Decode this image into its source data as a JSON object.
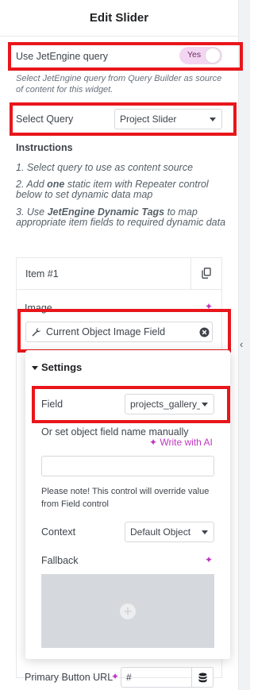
{
  "header": {
    "title": "Edit Slider"
  },
  "query_toggle": {
    "label": "Use JetEngine query",
    "value": "Yes",
    "help": "Select JetEngine query from Query Builder as source of content for this widget."
  },
  "select_query": {
    "label": "Select Query",
    "value": "Project Slider"
  },
  "instructions": {
    "title": "Instructions",
    "step1": "1. Select query to use as content source",
    "step2_pre": "2. Add ",
    "step2_bold": "one",
    "step2_post": " static item with Repeater control below to set dynamic data map",
    "step3_pre": "3. Use ",
    "step3_bold": "JetEngine Dynamic Tags",
    "step3_post": " to map appropriate item fields to required dynamic data"
  },
  "item": {
    "title": "Item #1",
    "image_label": "Image",
    "image_dynamic_value": "Current Object Image Field"
  },
  "settings_popover": {
    "title": "Settings",
    "field_label": "Field",
    "field_value": "projects_gallery_",
    "manual_label": "Or set object field name manually",
    "write_ai": "Write with AI",
    "manual_value": "",
    "note": "Please note! This control will override value from Field control",
    "context_label": "Context",
    "context_value": "Default Object",
    "fallback_label": "Fallback"
  },
  "primary_button": {
    "label": "Primary Button URL",
    "value": "#"
  },
  "colors": {
    "highlight": "#e8161b",
    "toggle_bg": "#f3d6f1",
    "ai_accent": "#c036c0"
  },
  "icons": [
    "copy-icon",
    "sparkle-icon",
    "wrench-icon",
    "clear-icon",
    "caret-down-icon",
    "plus-icon",
    "database-icon",
    "chevron-left-icon"
  ]
}
